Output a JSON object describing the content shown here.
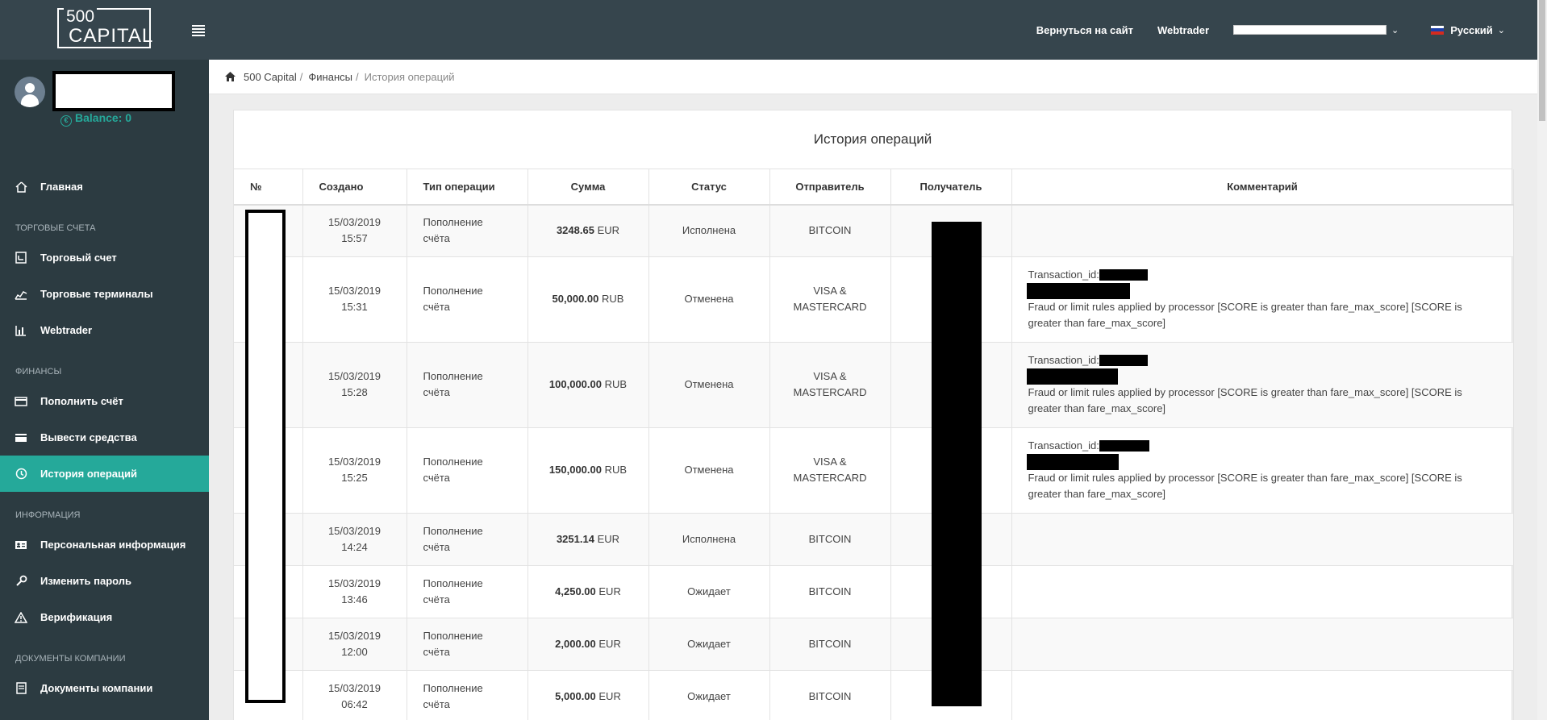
{
  "header": {
    "logo_top": "500",
    "logo_bottom": "CAPITAL",
    "back_link": "Вернуться на сайт",
    "webtrader_link": "Webtrader",
    "language": "Русский"
  },
  "sidebar": {
    "balance": "Balance: 0",
    "items": [
      {
        "type": "item",
        "label": "Главная",
        "icon": "home-icon"
      },
      {
        "type": "section",
        "label": "Торговые счета"
      },
      {
        "type": "item",
        "label": "Торговый счет",
        "icon": "account-icon"
      },
      {
        "type": "item",
        "label": "Торговые терминалы",
        "icon": "chart-icon"
      },
      {
        "type": "item",
        "label": "Webtrader",
        "icon": "bar-chart-icon"
      },
      {
        "type": "section",
        "label": "Финансы"
      },
      {
        "type": "item",
        "label": "Пополнить счёт",
        "icon": "credit-card-icon"
      },
      {
        "type": "item",
        "label": "Вывести средства",
        "icon": "card-withdraw-icon"
      },
      {
        "type": "item",
        "label": "История операций",
        "icon": "history-icon",
        "active": true
      },
      {
        "type": "section",
        "label": "Информация"
      },
      {
        "type": "item",
        "label": "Персональная информация",
        "icon": "id-card-icon"
      },
      {
        "type": "item",
        "label": "Изменить пароль",
        "icon": "key-icon"
      },
      {
        "type": "item",
        "label": "Верификация",
        "icon": "warning-icon"
      },
      {
        "type": "section",
        "label": "Документы компании"
      },
      {
        "type": "item",
        "label": "Документы компании",
        "icon": "document-icon"
      }
    ]
  },
  "breadcrumb": {
    "home": "500 Capital",
    "finance": "Финансы",
    "current": "История операций"
  },
  "panel": {
    "title": "История операций"
  },
  "table": {
    "headers": [
      "№",
      "Создано",
      "Тип операции",
      "Сумма",
      "Статус",
      "Отправитель",
      "Получатель",
      "Комментарий"
    ],
    "rows": [
      {
        "date": "15/03/2019",
        "time": "15:57",
        "type1": "Пополнение",
        "type2": "счёта",
        "amount": "3248.65",
        "currency": "EUR",
        "status": "Исполнена",
        "sender1": "BITCOIN",
        "sender2": "",
        "tx_label": "",
        "comment": ""
      },
      {
        "date": "15/03/2019",
        "time": "15:31",
        "type1": "Пополнение",
        "type2": "счёта",
        "amount": "50,000.00",
        "currency": "RUB",
        "status": "Отменена",
        "sender1": "VISA &",
        "sender2": "MASTERCARD",
        "tx_label": "Transaction_id:",
        "comment": "Fraud or limit rules applied by processor [SCORE is greater than fare_max_score] [SCORE is greater than fare_max_score]"
      },
      {
        "date": "15/03/2019",
        "time": "15:28",
        "type1": "Пополнение",
        "type2": "счёта",
        "amount": "100,000.00",
        "currency": "RUB",
        "status": "Отменена",
        "sender1": "VISA &",
        "sender2": "MASTERCARD",
        "tx_label": "Transaction_id:",
        "comment": "Fraud or limit rules applied by processor [SCORE is greater than fare_max_score] [SCORE is greater than fare_max_score]"
      },
      {
        "date": "15/03/2019",
        "time": "15:25",
        "type1": "Пополнение",
        "type2": "счёта",
        "amount": "150,000.00",
        "currency": "RUB",
        "status": "Отменена",
        "sender1": "VISA &",
        "sender2": "MASTERCARD",
        "tx_label": "Transaction_id:",
        "comment": "Fraud or limit rules applied by processor [SCORE is greater than fare_max_score] [SCORE is greater than fare_max_score]"
      },
      {
        "date": "15/03/2019",
        "time": "14:24",
        "type1": "Пополнение",
        "type2": "счёта",
        "amount": "3251.14",
        "currency": "EUR",
        "status": "Исполнена",
        "sender1": "BITCOIN",
        "sender2": "",
        "tx_label": "",
        "comment": ""
      },
      {
        "date": "15/03/2019",
        "time": "13:46",
        "type1": "Пополнение",
        "type2": "счёта",
        "amount": "4,250.00",
        "currency": "EUR",
        "status": "Ожидает",
        "sender1": "BITCOIN",
        "sender2": "",
        "tx_label": "",
        "comment": ""
      },
      {
        "date": "15/03/2019",
        "time": "12:00",
        "type1": "Пополнение",
        "type2": "счёта",
        "amount": "2,000.00",
        "currency": "EUR",
        "status": "Ожидает",
        "sender1": "BITCOIN",
        "sender2": "",
        "tx_label": "",
        "comment": ""
      },
      {
        "date": "15/03/2019",
        "time": "06:42",
        "type1": "Пополнение",
        "type2": "счёта",
        "amount": "5,000.00",
        "currency": "EUR",
        "status": "Ожидает",
        "sender1": "BITCOIN",
        "sender2": "",
        "tx_label": "",
        "comment": ""
      }
    ]
  },
  "colors": {
    "topbar": "#36454d",
    "sidebar": "#2c3b41",
    "accent": "#25a99a"
  }
}
